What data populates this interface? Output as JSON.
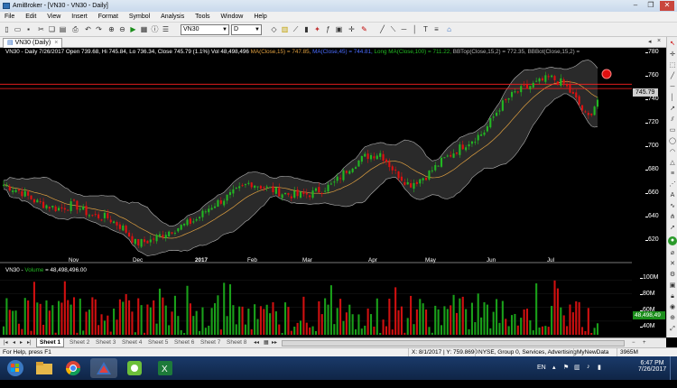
{
  "window": {
    "title": "AmiBroker - [VN30 - VN30 - Daily]"
  },
  "menu": [
    "File",
    "Edit",
    "View",
    "Insert",
    "Format",
    "Symbol",
    "Analysis",
    "Tools",
    "Window",
    "Help"
  ],
  "toolbar": {
    "symbol": "VN30",
    "interval": "D"
  },
  "doc_tab": "VN30 (Daily)",
  "chart_title": {
    "main": "VN30 - Daily 7/26/2017 Open 739.68, Hi 745.84, Lo 736.34, Close 745.79 (1.1%) Vol 48,498,496",
    "ma": "MA(Close,15) = 747.85,",
    "ma45": "MA(Close,45) = 744.81,",
    "longma": "Long MA(Close,100) = 711.22,",
    "bbtop": "BBTop(Close,15,2) = 772.35,",
    "bbbot": "BBBot(Close,15,2) ="
  },
  "volume_title": {
    "prefix": "VN30 - ",
    "name": "Volume",
    "value": " = 48,498,496.00"
  },
  "price_axis": [
    "780",
    "760",
    "740",
    "720",
    "700",
    "680",
    "660",
    "640",
    "620"
  ],
  "volume_axis": [
    "100M",
    "80M",
    "60M",
    "40M"
  ],
  "price_label": "745.79",
  "volume_label": "48,498,49",
  "date_axis": [
    "Nov",
    "Dec",
    "2017",
    "Feb",
    "Mar",
    "Apr",
    "May",
    "Jun",
    "Jul"
  ],
  "sheets": [
    "Sheet 1",
    "Sheet 2",
    "Sheet 3",
    "Sheet 4",
    "Sheet 5",
    "Sheet 6",
    "Sheet 7",
    "Sheet 8"
  ],
  "status": {
    "help": "For Help, press F1",
    "coords": "X: 8/1/2017 | Y: 759.8690",
    "exchange": "NYSE, Group 0, Services, Advertising",
    "datasource": "MyNewData",
    "memory": "3965M"
  },
  "tray": {
    "lang": "EN",
    "time": "6:47 PM",
    "date": "7/26/2017"
  },
  "colors": {
    "up": "#22b822",
    "down": "#e01010",
    "bollinger": "#b4b4b4",
    "ma": "#e0a040",
    "line": "#ff2020"
  },
  "chart_data": {
    "type": "candlestick",
    "symbol": "VN30",
    "interval": "Daily",
    "last": {
      "date": "7/26/2017",
      "open": 739.68,
      "high": 745.84,
      "low": 736.34,
      "close": 745.79,
      "volume": 48498496
    },
    "ylim": [
      600,
      790
    ],
    "close_trend": [
      [
        "2016-10-12",
        668
      ],
      [
        "2016-10-20",
        662
      ],
      [
        "2016-10-28",
        652
      ],
      [
        "2016-11-07",
        646
      ],
      [
        "2016-11-15",
        650
      ],
      [
        "2016-11-23",
        640
      ],
      [
        "2016-12-01",
        638
      ],
      [
        "2016-12-09",
        628
      ],
      [
        "2016-12-15",
        614
      ],
      [
        "2016-12-22",
        617
      ],
      [
        "2016-12-29",
        624
      ],
      [
        "2017-01-06",
        630
      ],
      [
        "2017-01-13",
        636
      ],
      [
        "2017-01-20",
        648
      ],
      [
        "2017-01-31",
        660
      ],
      [
        "2017-02-08",
        670
      ],
      [
        "2017-02-16",
        665
      ],
      [
        "2017-02-24",
        660
      ],
      [
        "2017-03-03",
        658
      ],
      [
        "2017-03-10",
        660
      ],
      [
        "2017-03-20",
        668
      ],
      [
        "2017-03-28",
        684
      ],
      [
        "2017-04-05",
        694
      ],
      [
        "2017-04-12",
        697
      ],
      [
        "2017-04-19",
        680
      ],
      [
        "2017-04-26",
        668
      ],
      [
        "2017-05-04",
        676
      ],
      [
        "2017-05-12",
        690
      ],
      [
        "2017-05-22",
        704
      ],
      [
        "2017-06-01",
        716
      ],
      [
        "2017-06-09",
        740
      ],
      [
        "2017-06-16",
        752
      ],
      [
        "2017-06-23",
        758
      ],
      [
        "2017-07-03",
        766
      ],
      [
        "2017-07-10",
        760
      ],
      [
        "2017-07-17",
        742
      ],
      [
        "2017-07-21",
        728
      ],
      [
        "2017-07-26",
        745.79
      ]
    ],
    "volume_range_M": [
      20,
      110
    ],
    "horizontal_lines": [
      760,
      756
    ]
  }
}
